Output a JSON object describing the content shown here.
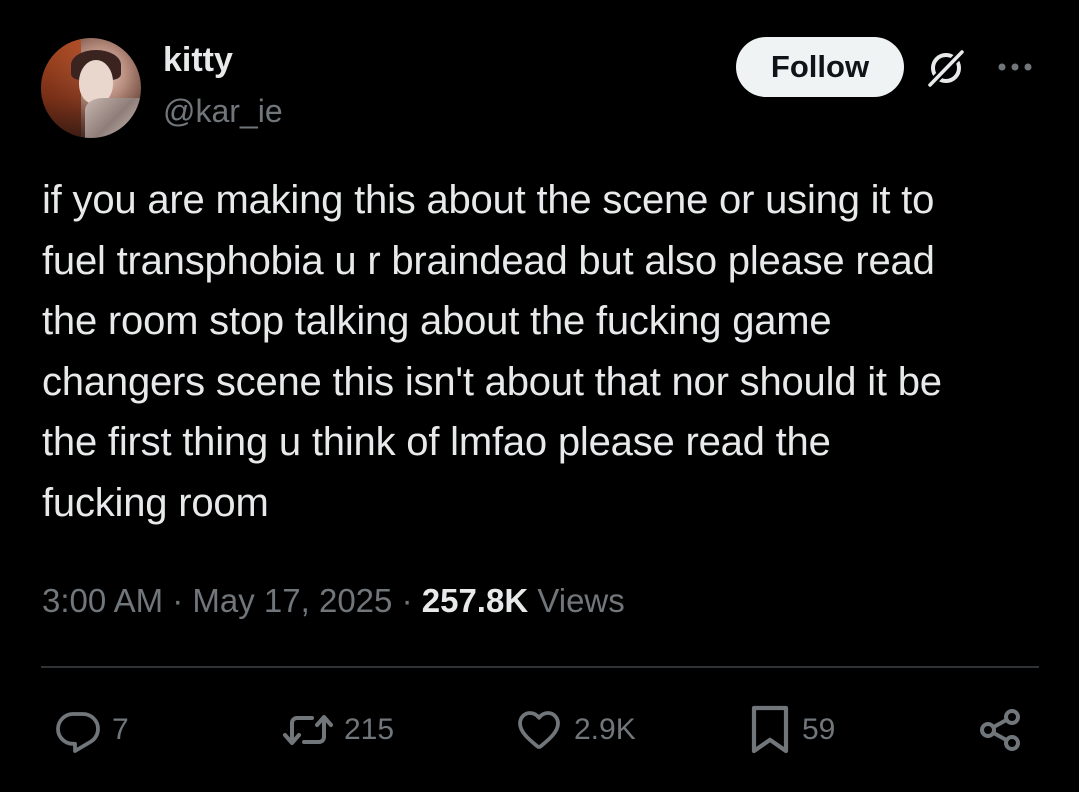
{
  "user": {
    "display_name": "kitty",
    "handle": "@kar_ie",
    "avatar_icon": "profile-photo"
  },
  "header": {
    "follow_label": "Follow",
    "grok_icon": "grok-icon",
    "more_icon": "more-icon"
  },
  "tweet": {
    "text": "if you are making this about the scene or using it to\nfuel transphobia u r braindead but also please read\nthe room stop talking about the fucking game\nchangers scene this isn't about that nor should it be\nthe first thing u think of lmfao please read the\nfucking room"
  },
  "meta": {
    "time": "3:00 AM",
    "separator": "·",
    "date": "May 17, 2025",
    "views_count": "257.8K",
    "views_label": "Views"
  },
  "actions": {
    "replies": "7",
    "reposts": "215",
    "likes": "2.9K",
    "bookmarks": "59"
  },
  "colors": {
    "background": "#000000",
    "primary_text": "#e7e9ea",
    "secondary_text": "#71767b",
    "follow_button_bg": "#eff3f4",
    "divider": "#2f3336"
  }
}
